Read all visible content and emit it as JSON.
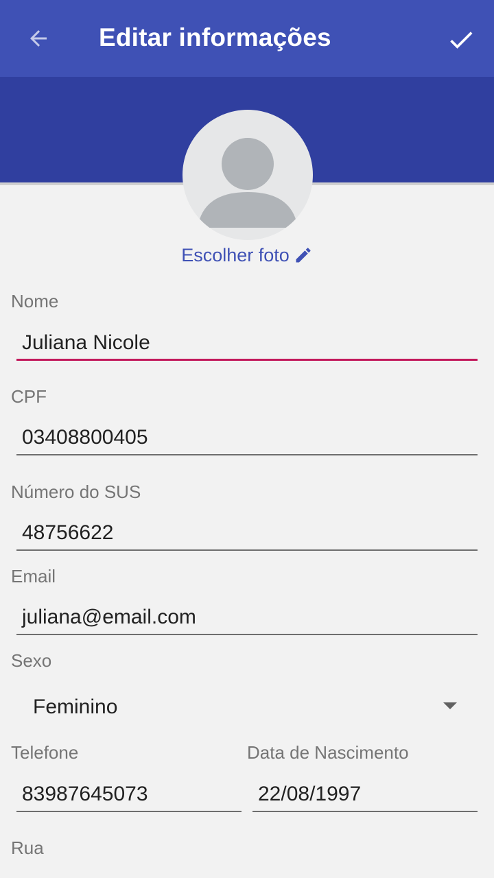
{
  "appbar": {
    "title": "Editar informações",
    "back_icon": "arrow-left-icon",
    "confirm_icon": "check-icon",
    "color": "#3f51b5",
    "banner_color": "#303f9f"
  },
  "profile": {
    "avatar_icon": "person-placeholder-icon",
    "choose_photo_label": "Escolher foto",
    "choose_photo_icon": "pencil-icon"
  },
  "form": {
    "nome": {
      "label": "Nome",
      "value": "Juliana Nicole"
    },
    "cpf": {
      "label": "CPF",
      "value": "03408800405"
    },
    "sus": {
      "label": "Número do SUS",
      "value": "48756622"
    },
    "email": {
      "label": "Email",
      "value": "juliana@email.com"
    },
    "sexo": {
      "label": "Sexo",
      "value": "Feminino"
    },
    "telefone": {
      "label": "Telefone",
      "value": "83987645073"
    },
    "nascimento": {
      "label": "Data de Nascimento",
      "value": "22/08/1997"
    },
    "rua": {
      "label": "Rua"
    }
  },
  "colors": {
    "accent": "#c2185b",
    "link": "#3f51b5"
  }
}
